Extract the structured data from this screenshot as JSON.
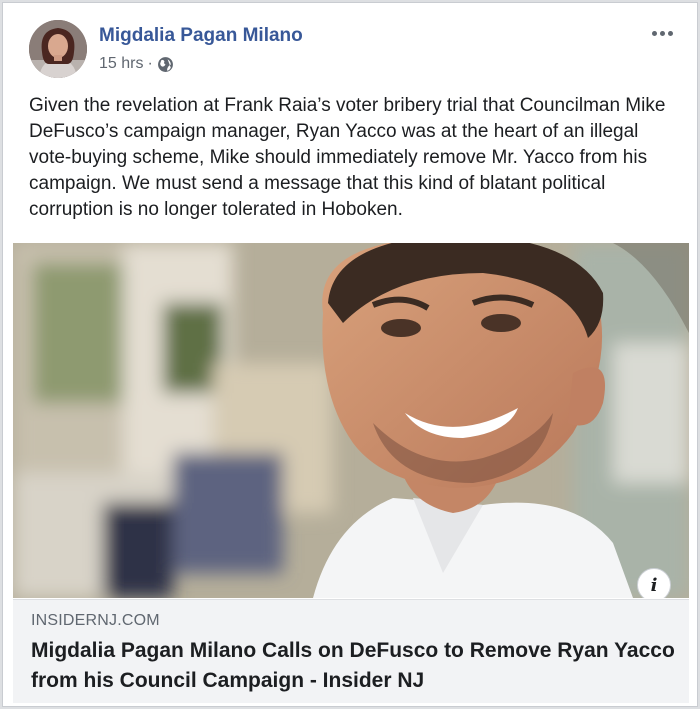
{
  "post": {
    "author": "Migdalia Pagan Milano",
    "time": "15 hrs",
    "separator": "·",
    "privacy_icon": "globe-icon",
    "more_icon": "more-options-icon",
    "text": "Given the revelation at Frank Raia’s voter bribery trial that Councilman Mike DeFusco’s campaign manager, Ryan Yacco was at the heart of an illegal vote-buying scheme, Mike should immediately remove Mr. Yacco from his campaign. We must send a message that this kind of blatant political corruption is no longer tolerated in Hoboken."
  },
  "link_preview": {
    "domain": "INSIDERNJ.COM",
    "title": "Migdalia Pagan Milano Calls on DeFusco to Remove Ryan Yacco from his Council Campaign - Insider NJ",
    "info_label": "i"
  },
  "colors": {
    "author_link": "#385898",
    "meta_text": "#606770",
    "body_text": "#1c1e21",
    "link_box_bg": "#f2f3f5"
  }
}
